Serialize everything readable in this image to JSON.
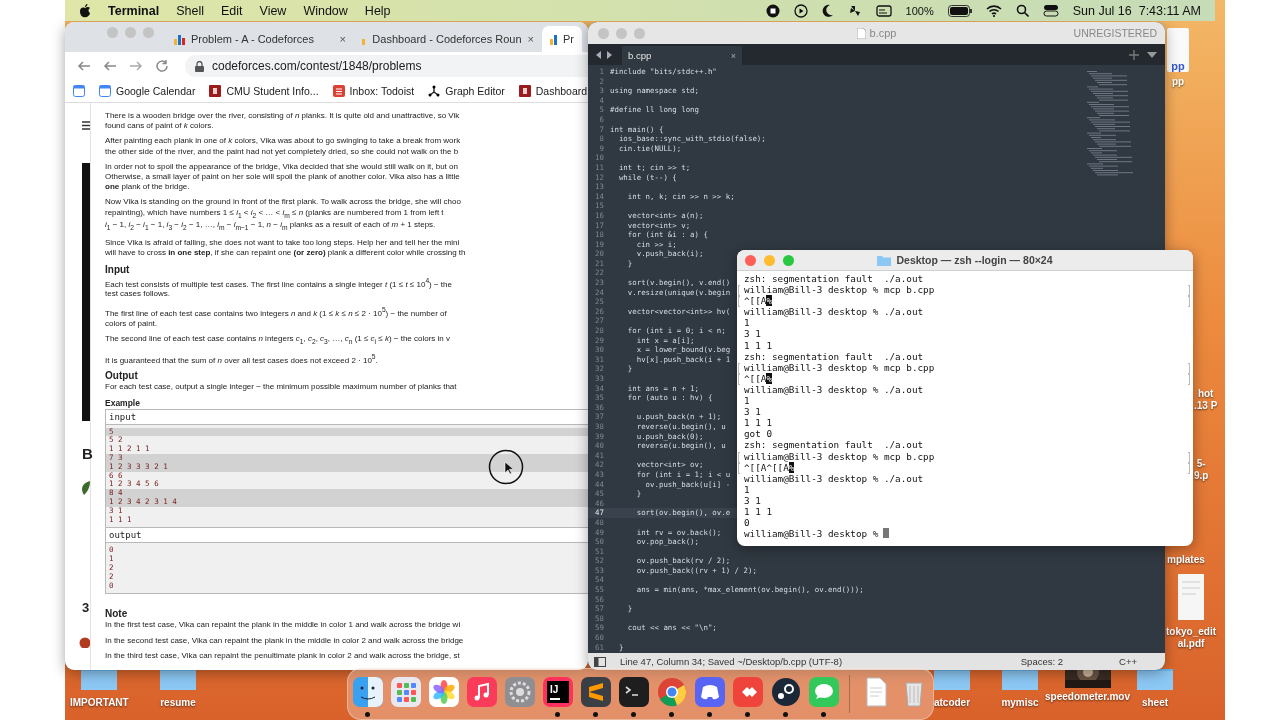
{
  "menu_bar": {
    "app": "Terminal",
    "menus": [
      "Shell",
      "Edit",
      "View",
      "Window",
      "Help"
    ],
    "battery": "100%",
    "clock": "Sun Jul 16  7:43:11 AM"
  },
  "browser": {
    "tabs": [
      {
        "title": "Problem - A - Codeforces",
        "close": "×",
        "selected": false
      },
      {
        "title": "Dashboard - Codeforces Roun",
        "close": "×",
        "selected": false
      },
      {
        "title": "Pr",
        "selected": true
      }
    ],
    "url": "codeforces.com/contest/1848/problems",
    "bookmarks": [
      {
        "label": "Google Calendar",
        "kind": "calendar"
      },
      {
        "label": "CMU Student Info...",
        "kind": "cmu"
      },
      {
        "label": "Inbox: Todoist",
        "kind": "todoist"
      },
      {
        "label": "Graph Editor",
        "kind": "graph"
      },
      {
        "label": "Dashboard",
        "kind": "cmu"
      }
    ],
    "side_texts": [
      "B",
      "3"
    ],
    "statement": [
      {
        "kind": "para",
        "lines": [
          "There is a wooden bridge over the river, consisting of *n* planks. It is quite old and unattractive, so Vik",
          "found cans of paint of *k* colors."
        ]
      },
      {
        "kind": "para",
        "lines": [
          "After painting each plank in one of *k* colors, Vika was about to go swinging to take a break from work",
          "the other side of the river, and the paint had not yet completely dried, so she could not walk on the b"
        ]
      },
      {
        "kind": "para",
        "lines": [
          "In order not to spoil the appearance of the bridge, Vika decided that she would still walk on it, but on",
          "Otherwise, a small layer of paint on her sole will spoil the plank of another color. Vika also has a little",
          "**one** plank of the bridge."
        ]
      },
      {
        "kind": "para",
        "lines": [
          "Now Vika is standing on the ground in front of the first plank. To walk across the bridge, she will choo",
          "repainting), which have numbers 1 ≤ *i*$_{1}$ < *i*$_{2}$ < … < *i*$_{m}$ ≤ *n* (planks are numbered from 1 from left t",
          "*i*$_{1}$ − 1, *i*$_{2}$ − *i*$_{1}$ − 1, *i*$_{3}$ − *i*$_{2}$ − 1, …, *i*$_{m}$ − *i*$_{m−1}$ − 1, *n* − *i*$_{m}$ planks as a result of each of *m* + 1 steps."
        ]
      },
      {
        "kind": "para",
        "lines": [
          "Since Vika is afraid of falling, she does not want to take too long steps. Help her and tell her the mini",
          "will have to cross **in one step**, if she can repaint one **(or zero)** plank a different color while crossing th"
        ]
      },
      {
        "kind": "heading",
        "text": "Input"
      },
      {
        "kind": "para",
        "lines": [
          "Each test consists of multiple test cases. The first line contains a single integer *t* (1 ≤ *t* ≤ 10$^{4}$) − the",
          "test cases follows."
        ]
      },
      {
        "kind": "para",
        "lines": [
          "The first line of each test case contains two integers *n* and *k* (1 ≤ *k* ≤ *n* ≤ 2 · 10$^{5}$) − the number of",
          "colors of paint."
        ]
      },
      {
        "kind": "para",
        "lines": [
          "The second line of each test case contains *n* integers *c*$_{1}$, *c*$_{2}$, *c*$_{3}$, …, *c*$_{n}$ (1 ≤ *c*$_{i}$ ≤ *k*) − the colors in v"
        ]
      },
      {
        "kind": "para",
        "lines": [
          "It is guaranteed that the sum of *n* over all test cases does not exceed 2 · 10$^{5}$."
        ]
      },
      {
        "kind": "heading",
        "text": "Output"
      },
      {
        "kind": "para",
        "lines": [
          "For each test case, output a single integer − the minimum possible maximum number of planks that"
        ]
      },
      {
        "kind": "subheading",
        "text": "Example"
      },
      {
        "kind": "sample",
        "title": "input",
        "lines": [
          {
            "text": "5",
            "shaded": true
          },
          {
            "text": "5 2",
            "shaded": false
          },
          {
            "text": "1 1 2 1 1",
            "shaded": false
          },
          {
            "text": "7 3",
            "shaded": true
          },
          {
            "text": "1 2 3 3 3 2 1",
            "shaded": true
          },
          {
            "text": "6 6",
            "shaded": false
          },
          {
            "text": "1 2 3 4 5 6",
            "shaded": false
          },
          {
            "text": "8 4",
            "shaded": true
          },
          {
            "text": "1 2 3 4 2 3 1 4",
            "shaded": true
          },
          {
            "text": "3 1",
            "shaded": false
          },
          {
            "text": "1 1 1",
            "shaded": false
          }
        ]
      },
      {
        "kind": "sample",
        "title": "output",
        "lines": [
          {
            "text": "0",
            "shaded": false
          },
          {
            "text": "1",
            "shaded": false
          },
          {
            "text": "2",
            "shaded": false
          },
          {
            "text": "2",
            "shaded": false
          },
          {
            "text": "0",
            "shaded": false
          }
        ]
      },
      {
        "kind": "heading",
        "text": "Note"
      },
      {
        "kind": "para",
        "lines": [
          "In the first test case, Vika can repaint the plank in the middle in color 1 and walk across the bridge wi"
        ]
      },
      {
        "kind": "para",
        "lines": [
          "In the second test case, Vika can repaint the plank in the middle in color 2 and walk across the bridge"
        ]
      },
      {
        "kind": "para",
        "lines": [
          "In the third test case, Vika can repaint the penultimate plank in color 2 and walk across the bridge, st"
        ]
      }
    ]
  },
  "editor": {
    "title": "b.cpp",
    "registration": "UNREGISTERED",
    "tab": "b.cpp",
    "tab_close": "×",
    "lines": [
      {
        "n": "1",
        "code": "#include \"bits/stdc++.h\"",
        "current": false
      },
      {
        "n": "2",
        "current": false
      },
      {
        "n": "3",
        "code": "using namespace std;",
        "current": false
      },
      {
        "n": "4",
        "current": false
      },
      {
        "n": "5",
        "code": "#define ll long long",
        "current": false
      },
      {
        "n": "6",
        "current": false
      },
      {
        "n": "7",
        "code": "int main() {",
        "current": false
      },
      {
        "n": "8",
        "code": "  ios_base::sync_with_stdio(false);",
        "current": false
      },
      {
        "n": "9",
        "code": "  cin.tie(NULL);",
        "current": false
      },
      {
        "n": "10",
        "current": false
      },
      {
        "n": "11",
        "code": "  int t; cin >> t;",
        "current": false
      },
      {
        "n": "12",
        "code": "  while (t--) {",
        "current": false
      },
      {
        "n": "13",
        "current": false
      },
      {
        "n": "14",
        "code": "    int n, k; cin >> n >> k;",
        "current": false
      },
      {
        "n": "15",
        "current": false
      },
      {
        "n": "16",
        "code": "    vector<int> a(n);",
        "current": false
      },
      {
        "n": "17",
        "code": "    vector<int> v;",
        "current": false
      },
      {
        "n": "18",
        "code": "    for (int &i : a) {",
        "current": false
      },
      {
        "n": "19",
        "code": "      cin >> i;",
        "current": false
      },
      {
        "n": "20",
        "code": "      v.push_back(i);",
        "current": false
      },
      {
        "n": "21",
        "code": "    }",
        "current": false
      },
      {
        "n": "22",
        "current": false
      },
      {
        "n": "23",
        "code": "    sort(v.begin(), v.end()",
        "current": false
      },
      {
        "n": "24",
        "code": "    v.resize(unique(v.begin",
        "current": false
      },
      {
        "n": "25",
        "current": false
      },
      {
        "n": "26",
        "code": "    vector<vector<int>> hv(",
        "current": false
      },
      {
        "n": "27",
        "current": false
      },
      {
        "n": "28",
        "code": "    for (int i = 0; i < n;",
        "current": false
      },
      {
        "n": "29",
        "code": "      int x = a[i];",
        "current": false
      },
      {
        "n": "30",
        "code": "      x = lower_bound(v.beg",
        "current": false
      },
      {
        "n": "31",
        "code": "      hv[x].push_back(i + 1",
        "current": false
      },
      {
        "n": "32",
        "code": "    }",
        "current": false
      },
      {
        "n": "33",
        "current": false
      },
      {
        "n": "34",
        "code": "    int ans = n + 1;",
        "current": false
      },
      {
        "n": "35",
        "code": "    for (auto u : hv) {",
        "current": false
      },
      {
        "n": "36",
        "current": false
      },
      {
        "n": "37",
        "code": "      u.push_back(n + 1);",
        "current": false
      },
      {
        "n": "38",
        "code": "      reverse(u.begin(), u",
        "current": false
      },
      {
        "n": "39",
        "code": "      u.push_back(0);",
        "current": false
      },
      {
        "n": "40",
        "code": "      reverse(u.begin(), u",
        "current": false
      },
      {
        "n": "41",
        "current": false
      },
      {
        "n": "42",
        "code": "      vector<int> ov;",
        "current": false
      },
      {
        "n": "43",
        "code": "      for (int i = 1; i < u",
        "current": false
      },
      {
        "n": "44",
        "code": "        ov.push_back(u[i] -",
        "current": false
      },
      {
        "n": "45",
        "code": "      }",
        "current": false
      },
      {
        "n": "46",
        "current": false
      },
      {
        "n": "47",
        "code": "      sort(ov.begin(), ov.e",
        "current": true
      },
      {
        "n": "48",
        "current": false
      },
      {
        "n": "49",
        "code": "      int rv = ov.back();",
        "current": false
      },
      {
        "n": "50",
        "code": "      ov.pop_back();",
        "current": false
      },
      {
        "n": "51",
        "current": false
      },
      {
        "n": "52",
        "code": "      ov.push_back(rv / 2);",
        "current": false
      },
      {
        "n": "53",
        "code": "      ov.push_back((rv + 1) / 2);",
        "current": false
      },
      {
        "n": "54",
        "current": false
      },
      {
        "n": "55",
        "code": "      ans = min(ans, *max_element(ov.begin(), ov.end()));",
        "current": false
      },
      {
        "n": "56",
        "current": false
      },
      {
        "n": "57",
        "code": "    }",
        "current": false
      },
      {
        "n": "58",
        "current": false
      },
      {
        "n": "59",
        "code": "    cout << ans << \"\\n\";",
        "current": false
      },
      {
        "n": "60",
        "current": false
      },
      {
        "n": "61",
        "code": "  }",
        "current": false
      }
    ],
    "status": {
      "position": "Line 47, Column 34; Saved ~/Desktop/b.cpp (UTF-8)",
      "indent": "Spaces: 2",
      "syntax": "C++"
    }
  },
  "terminal": {
    "title": "Desktop — zsh --login — 80×24",
    "cursor": true,
    "lines": [
      {
        "text": "zsh: segmentation fault  ./a.out",
        "marked": false
      },
      {
        "text": "william@Bill-3 desktop % mcp b.cpp",
        "marked": true
      },
      {
        "text": "^[[A",
        "marker": "%",
        "marked": true
      },
      {
        "text": "william@Bill-3 desktop % ./a.out",
        "marked": false
      },
      {
        "text": "1",
        "marked": false
      },
      {
        "text": "3 1",
        "marked": false
      },
      {
        "text": "1 1 1",
        "marked": false
      },
      {
        "text": "zsh: segmentation fault  ./a.out",
        "marked": false
      },
      {
        "text": "william@Bill-3 desktop % mcp b.cpp",
        "marked": true
      },
      {
        "text": "^[[A",
        "marker": "%",
        "marked": true
      },
      {
        "text": "william@Bill-3 desktop % ./a.out",
        "marked": false
      },
      {
        "text": "1",
        "marked": false
      },
      {
        "text": "3 1",
        "marked": false
      },
      {
        "text": "1 1 1",
        "marked": false
      },
      {
        "text": "got 0",
        "marked": false
      },
      {
        "text": "zsh: segmentation fault  ./a.out",
        "marked": false
      },
      {
        "text": "william@Bill-3 desktop % mcp b.cpp",
        "marked": true
      },
      {
        "text": "^[[A^[[A",
        "marker": "%",
        "marked": true
      },
      {
        "text": "william@Bill-3 desktop % ./a.out",
        "marked": false
      },
      {
        "text": "1",
        "marked": false
      },
      {
        "text": "3 1",
        "marked": false
      },
      {
        "text": "1 1 1",
        "marked": false
      },
      {
        "text": "0",
        "marked": false
      },
      {
        "text": "william@Bill-3 desktop %",
        "marked": false
      }
    ]
  },
  "desktop_items": [
    {
      "kind": "document",
      "lines": [
        "pp"
      ],
      "preview": "pp"
    },
    {
      "kind": "label",
      "lines": [
        "hot",
        ".13 P"
      ]
    },
    {
      "kind": "label",
      "lines": [
        "5-",
        "9.p"
      ]
    },
    {
      "kind": "label",
      "lines": [
        "mplates"
      ]
    },
    {
      "kind": "pdf",
      "lines": [
        "tokyo_edit",
        "al.pdf"
      ]
    },
    {
      "kind": "folder",
      "lines": [
        "IMPORTANT"
      ]
    },
    {
      "kind": "folder",
      "lines": [
        "resume"
      ]
    },
    {
      "kind": "folder",
      "lines": [
        "atcoder"
      ]
    },
    {
      "kind": "folder",
      "lines": [
        "mymisc"
      ]
    },
    {
      "kind": "video",
      "lines": [
        "speedometer.mov"
      ]
    },
    {
      "kind": "folder",
      "lines": [
        "sheet"
      ]
    }
  ],
  "dock": [
    {
      "kind": "finder",
      "running": true
    },
    {
      "kind": "launchpad",
      "running": false
    },
    {
      "kind": "photos",
      "running": false
    },
    {
      "kind": "music",
      "running": false
    },
    {
      "kind": "settings",
      "running": false
    },
    {
      "kind": "intellij",
      "glyph": "IJ",
      "running": true
    },
    {
      "kind": "sublime",
      "running": true
    },
    {
      "kind": "terminal",
      "running": true
    },
    {
      "kind": "chrome",
      "running": true
    },
    {
      "kind": "discord",
      "running": true
    },
    {
      "kind": "remote",
      "running": true
    },
    {
      "kind": "steam",
      "running": true
    },
    {
      "kind": "messages",
      "running": true
    },
    {
      "kind": "separator"
    },
    {
      "kind": "document",
      "running": false
    },
    {
      "kind": "trash",
      "running": false
    }
  ]
}
